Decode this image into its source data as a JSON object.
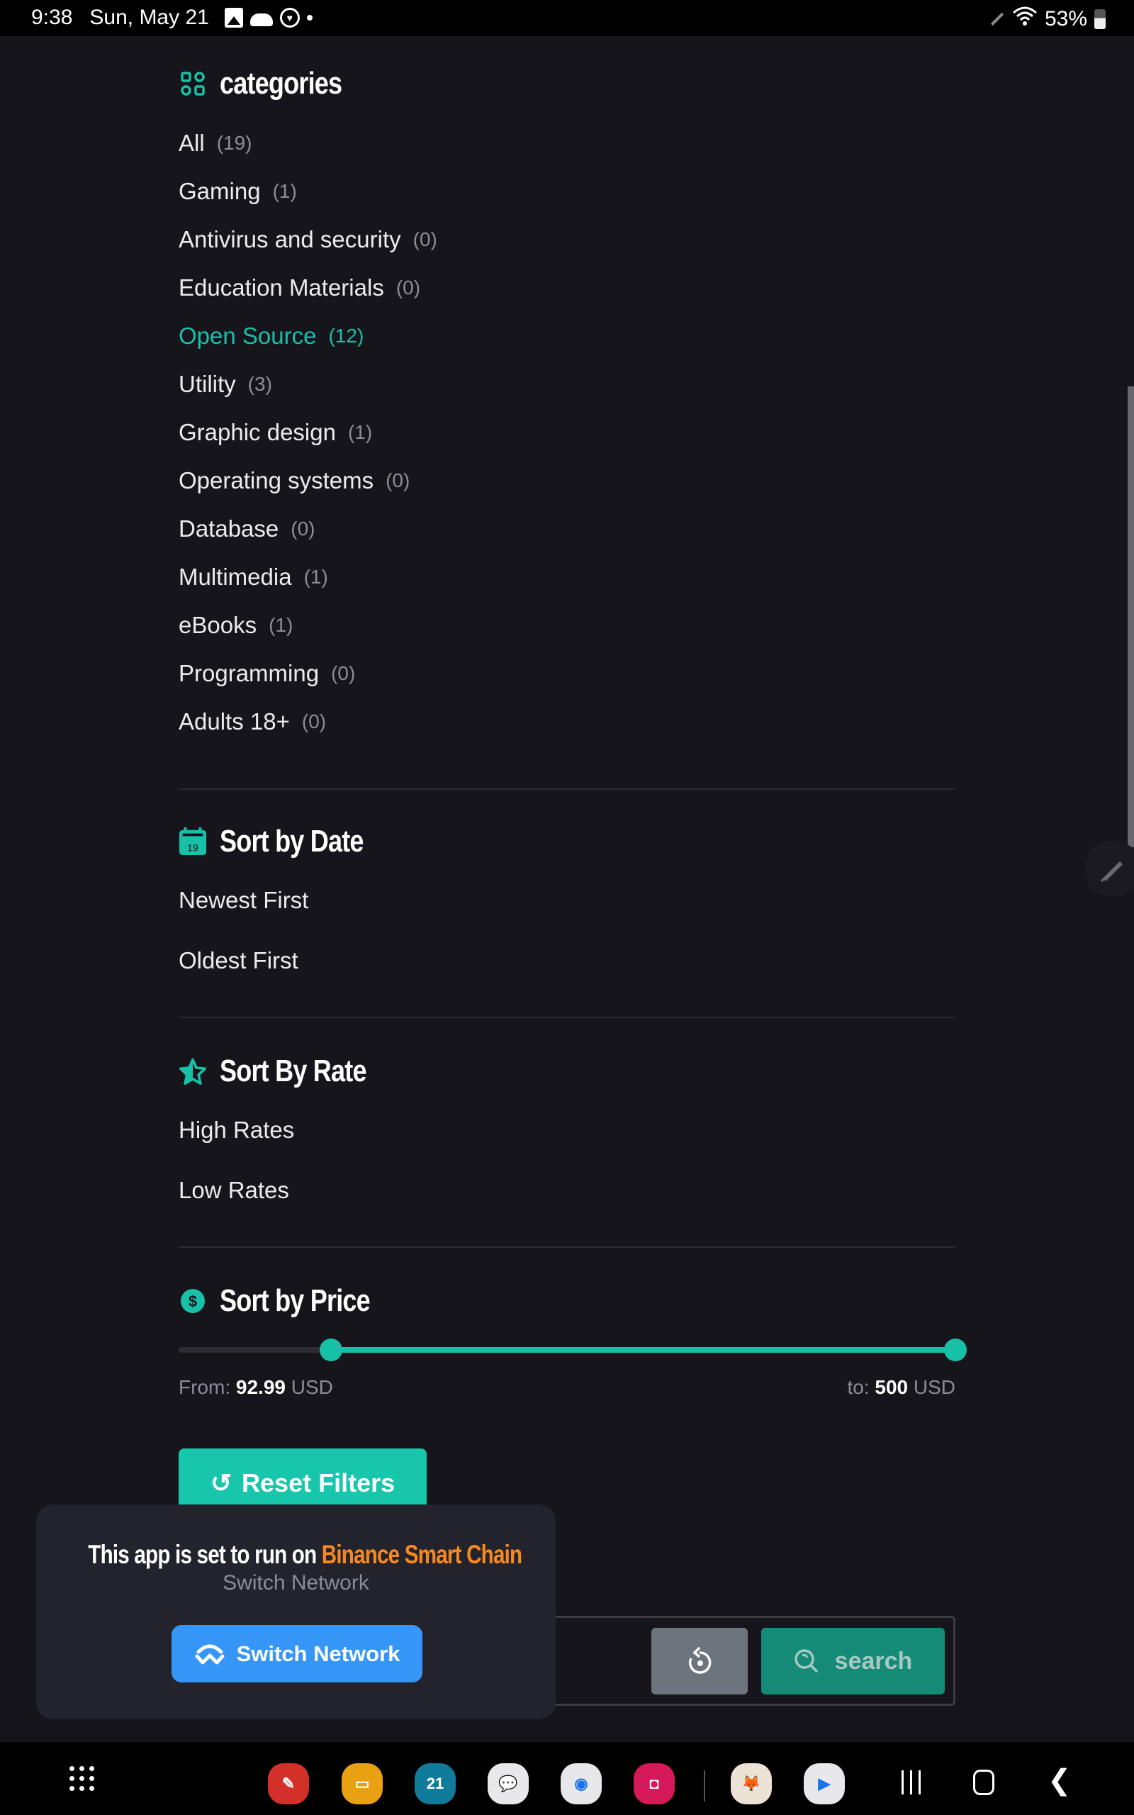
{
  "status_bar": {
    "time": "9:38",
    "date": "Sun, May 21",
    "notification_icons": [
      "gallery-icon",
      "cloud-icon",
      "health-icon",
      "more-dot-icon"
    ],
    "right_icons": [
      "s-pen-icon",
      "wifi-icon",
      "battery-icon"
    ],
    "battery": "53%"
  },
  "categories": {
    "title": "categories",
    "icon": "category-grid-icon",
    "items": [
      {
        "label": "All",
        "count": "(19)",
        "active": false
      },
      {
        "label": "Gaming",
        "count": "(1)",
        "active": false
      },
      {
        "label": "Antivirus and security",
        "count": "(0)",
        "active": false
      },
      {
        "label": "Education Materials",
        "count": "(0)",
        "active": false
      },
      {
        "label": "Open Source",
        "count": "(12)",
        "active": true
      },
      {
        "label": "Utility",
        "count": "(3)",
        "active": false
      },
      {
        "label": "Graphic design",
        "count": "(1)",
        "active": false
      },
      {
        "label": "Operating systems",
        "count": "(0)",
        "active": false
      },
      {
        "label": "Database",
        "count": "(0)",
        "active": false
      },
      {
        "label": "Multimedia",
        "count": "(1)",
        "active": false
      },
      {
        "label": "eBooks",
        "count": "(1)",
        "active": false
      },
      {
        "label": "Programming",
        "count": "(0)",
        "active": false
      },
      {
        "label": "Adults 18+",
        "count": "(0)",
        "active": false
      }
    ]
  },
  "sort_by_date": {
    "title": "Sort by Date",
    "icon_text": "19",
    "options": [
      "Newest First",
      "Oldest First"
    ]
  },
  "sort_by_rate": {
    "title": "Sort By Rate",
    "options": [
      "High Rates",
      "Low Rates"
    ]
  },
  "sort_by_price": {
    "title": "Sort by Price",
    "icon_text": "$",
    "from_label": "From:",
    "from_value": "92.99",
    "to_label": "to:",
    "to_value": "500",
    "currency": "USD",
    "slider_min_fraction": 0.196,
    "slider_max_fraction": 1.0
  },
  "reset_button": {
    "label": "Reset Filters"
  },
  "search_bar": {
    "search_label": "search"
  },
  "network_popup": {
    "title_prefix": "This app is set to run on",
    "chain_name": "Binance Smart Chain",
    "subtitle": "Switch Network",
    "button_label": "Switch Network"
  },
  "dock": {
    "apps": [
      {
        "name": "notes-app-icon",
        "color": "#d4302a",
        "glyph": "✎"
      },
      {
        "name": "files-app-icon",
        "color": "#e9a013",
        "glyph": "▭"
      },
      {
        "name": "calendar-app-icon",
        "color": "#117b9b",
        "glyph": "21"
      },
      {
        "name": "messages-app-icon",
        "color": "#e8e8ea",
        "glyph": "💬"
      },
      {
        "name": "chrome-app-icon",
        "color": "#e8e8ea",
        "glyph": "◉"
      },
      {
        "name": "camera-app-icon",
        "color": "#d5185a",
        "glyph": "◘"
      },
      {
        "name": "metamask-app-icon",
        "color": "#ece2d6",
        "glyph": "🦊"
      },
      {
        "name": "play-store-app-icon",
        "color": "#e8e8ea",
        "glyph": "▶"
      }
    ]
  },
  "colors": {
    "accent": "#17c1a8",
    "background": "#16151b",
    "chain_orange": "#f7881f",
    "switch_blue": "#3596f7"
  }
}
